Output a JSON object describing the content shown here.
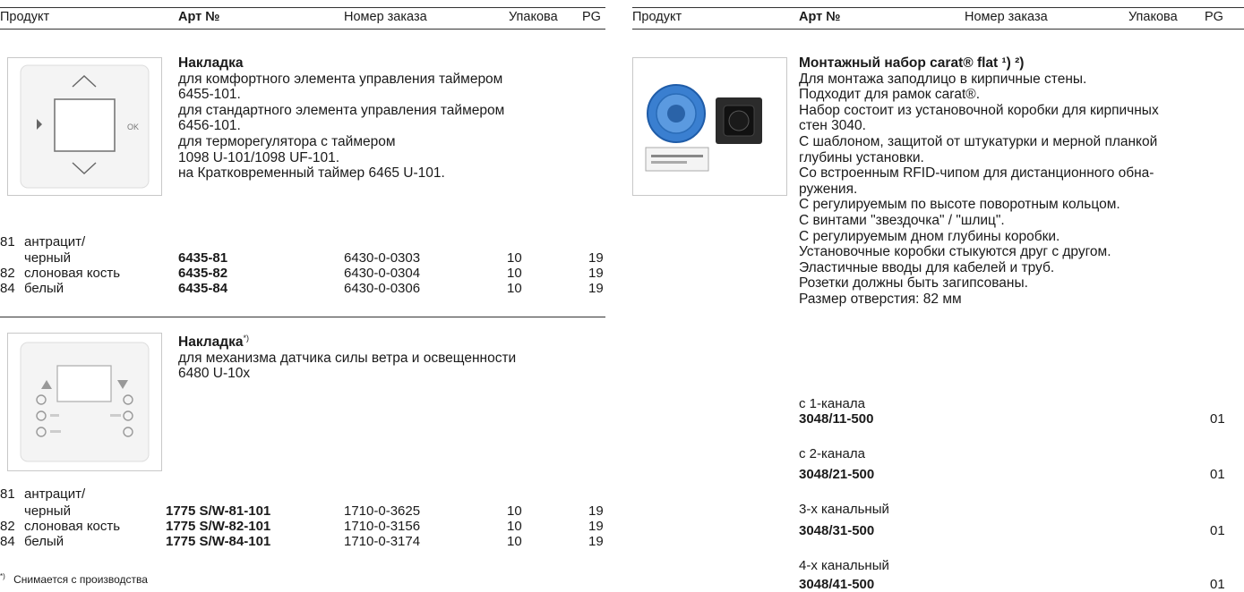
{
  "left": {
    "header": {
      "product": "Продукт",
      "art": "Арт №",
      "order": "Номер заказа",
      "pack": "Упакова",
      "pg": "PG"
    },
    "item1": {
      "title": "Накладка",
      "lines": [
        "для комфортного элемента управления таймером",
        "6455-101.",
        "для стандартного элемента управления таймером",
        "6456-101.",
        "для терморегулятора с таймером",
        "1098 U-101/1098 UF-101.",
        "на Кратковременный таймер 6465 U-101."
      ],
      "image_label": "OK",
      "rows": [
        {
          "code": "81",
          "color": "антрацит/",
          "art": "",
          "order": "",
          "pack": "",
          "pg": ""
        },
        {
          "code": "",
          "color": "черный",
          "art": "6435-81",
          "order": "6430-0-0303",
          "pack": "10",
          "pg": "19"
        },
        {
          "code": "82",
          "color": "слоновая кость",
          "art": "6435-82",
          "order": "6430-0-0304",
          "pack": "10",
          "pg": "19"
        },
        {
          "code": "84",
          "color": "белый",
          "art": "6435-84",
          "order": "6430-0-0306",
          "pack": "10",
          "pg": "19"
        }
      ]
    },
    "item2": {
      "title": "Накладка",
      "title_mark": "*)",
      "lines": [
        "для механизма датчика силы ветра и освещенности",
        "6480 U-10x"
      ],
      "rows": [
        {
          "code": "81",
          "color": "антрацит/",
          "art": "",
          "order": "",
          "pack": "",
          "pg": ""
        },
        {
          "code": "",
          "color": "черный",
          "art": "1775 S/W-81-101",
          "order": "1710-0-3625",
          "pack": "10",
          "pg": "19"
        },
        {
          "code": "82",
          "color": "слоновая кость",
          "art": "1775 S/W-82-101",
          "order": "1710-0-3156",
          "pack": "10",
          "pg": "19"
        },
        {
          "code": "84",
          "color": "белый",
          "art": "1775 S/W-84-101",
          "order": "1710-0-3174",
          "pack": "10",
          "pg": "19"
        }
      ]
    },
    "footnote": {
      "mark": "*)",
      "text": "Снимается с производства"
    }
  },
  "right": {
    "header": {
      "product": "Продукт",
      "art": "Арт №",
      "order": "Номер заказа",
      "pack": "Упакова",
      "pg": "PG"
    },
    "item": {
      "title": "Монтажный набор carat® flat ¹) ²)",
      "lines": [
        "Для монтажа заподлицо в кирпичные стены.",
        "Подходит для рамок carat®.",
        "Набор состоит из установочной коробки для кирпичных",
        "стен 3040.",
        "С шаблоном, защитой от штукатурки и мерной планкой",
        "глубины установки.",
        "Со встроенным RFID-чипом для дистанционного обна-",
        "ружения.",
        "С регулируемым по высоте поворотным кольцом.",
        "С винтами \"звездочка\" / \"шлиц\".",
        "С регулируемым дном глубины коробки.",
        "Установочные коробки стыкуются друг с другом.",
        "Эластичные вводы для кабелей и труб.",
        "Розетки должны быть загипсованы.",
        "Размер отверстия: 82 мм"
      ],
      "variants": [
        {
          "label": "с 1-канала",
          "art": "3048/11-500",
          "pg": "01"
        },
        {
          "label": "с 2-канала",
          "art": "3048/21-500",
          "pg": "01"
        },
        {
          "label": "3-х канальный",
          "art": "3048/31-500",
          "pg": "01"
        },
        {
          "label": "4-х канальный",
          "art": "3048/41-500",
          "pg": "01"
        }
      ]
    }
  }
}
